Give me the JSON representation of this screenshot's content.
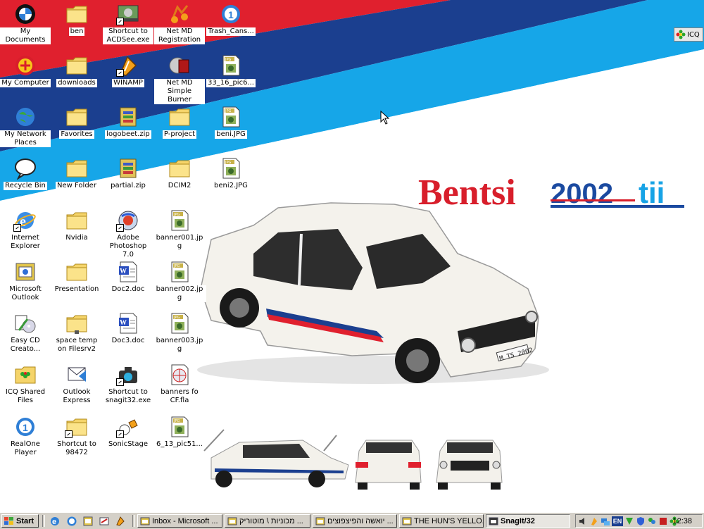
{
  "desktop": {
    "icons": [
      {
        "label": "My Documents",
        "icon": "bmw-logo-icon"
      },
      {
        "label": "ben",
        "icon": "folder-icon"
      },
      {
        "label": "Shortcut to ACDSee.exe",
        "icon": "acdsee-icon"
      },
      {
        "label": "Net MD Registration",
        "icon": "net-md-icon"
      },
      {
        "label": "Trash_Cans...",
        "icon": "realone-icon"
      },
      {
        "label": "My Computer",
        "icon": "my-computer-icon"
      },
      {
        "label": "downloads",
        "icon": "folder-icon"
      },
      {
        "label": "WINAMP",
        "icon": "winamp-icon"
      },
      {
        "label": "Net MD Simple Burner",
        "icon": "net-md-burner-icon"
      },
      {
        "label": "33_16_pic6...",
        "icon": "jpg-file-icon"
      },
      {
        "label": "My Network Places",
        "icon": "globe-icon"
      },
      {
        "label": "Favorites",
        "icon": "folder-icon"
      },
      {
        "label": "logobeet.zip",
        "icon": "zip-icon"
      },
      {
        "label": "P-project",
        "icon": "folder-icon"
      },
      {
        "label": "beni.JPG",
        "icon": "jpg-file-icon"
      },
      {
        "label": "Recycle Bin",
        "icon": "recycle-bin-icon"
      },
      {
        "label": "New Folder",
        "icon": "folder-icon"
      },
      {
        "label": "partial.zip",
        "icon": "zip-icon"
      },
      {
        "label": "DCIM2",
        "icon": "folder-icon"
      },
      {
        "label": "beni2.JPG",
        "icon": "jpg-file-icon"
      },
      {
        "label": "Internet Explorer",
        "icon": "internet-explorer-icon"
      },
      {
        "label": "Nvidia",
        "icon": "folder-icon"
      },
      {
        "label": "Adobe Photoshop 7.0",
        "icon": "photoshop-icon"
      },
      {
        "label": "banner001.jpg",
        "icon": "jpg-file-icon"
      },
      {
        "label": "Microsoft Outlook",
        "icon": "outlook-icon"
      },
      {
        "label": "Presentation",
        "icon": "folder-icon"
      },
      {
        "label": "Doc2.doc",
        "icon": "word-doc-icon"
      },
      {
        "label": "banner002.jpg",
        "icon": "jpg-file-icon"
      },
      {
        "label": "Easy CD Creato...",
        "icon": "easy-cd-icon"
      },
      {
        "label": "space temp on Filesrv2",
        "icon": "network-folder-icon"
      },
      {
        "label": "Doc3.doc",
        "icon": "word-doc-icon"
      },
      {
        "label": "banner003.jpg",
        "icon": "jpg-file-icon"
      },
      {
        "label": "ICQ Shared Files",
        "icon": "icq-folder-icon"
      },
      {
        "label": "Outlook Express",
        "icon": "outlook-express-icon"
      },
      {
        "label": "Shortcut to snagit32.exe",
        "icon": "snagit-icon"
      },
      {
        "label": "banners fo CF.fla",
        "icon": "flash-file-icon"
      },
      {
        "label": "RealOne Player",
        "icon": "realone-icon"
      },
      {
        "label": "Shortcut to 98472",
        "icon": "folder-icon"
      },
      {
        "label": "SonicStage",
        "icon": "sonicstage-icon"
      },
      {
        "label": "6_13_pic51...",
        "icon": "jpg-file-icon"
      }
    ]
  },
  "icq_float": {
    "label": "ICQ",
    "icon": "icq-flower-icon"
  },
  "wallpaper": {
    "logo_text_1": "Bentsi",
    "logo_text_2": "2002",
    "logo_text_3": "tii",
    "plate": "M TS 2002",
    "colors": {
      "red": "#e0202e",
      "dark_blue": "#1b3f8f",
      "light_blue": "#16a6e8",
      "logo_red": "#d81e2b",
      "logo_blue": "#1b4aa0",
      "logo_light": "#17a3e6"
    }
  },
  "taskbar": {
    "start_label": "Start",
    "tasks": [
      {
        "label": "Inbox - Microsoft ...",
        "icon": "outlook-icon",
        "active": false
      },
      {
        "label": "מכוניות \\ מוטוריק ...",
        "icon": "ie-page-icon",
        "active": false
      },
      {
        "label": "יואשה והפיצפוצים ...",
        "icon": "explorer-icon",
        "active": false
      },
      {
        "label": "THE HUN'S YELLO...",
        "icon": "ie-page-icon",
        "active": false
      },
      {
        "label": "SnagIt/32",
        "icon": "snagit-icon",
        "active": true
      }
    ],
    "clock": "12:38",
    "language": "EN"
  }
}
